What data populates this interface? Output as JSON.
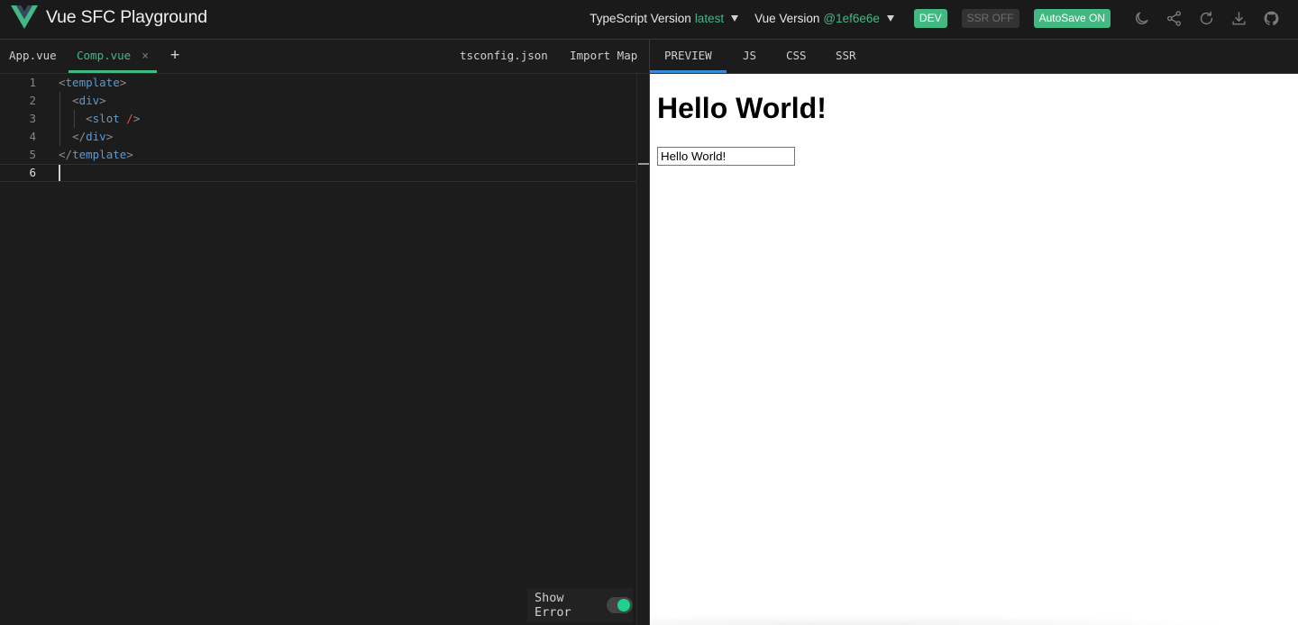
{
  "header": {
    "title": "Vue SFC Playground",
    "ts_label": "TypeScript Version",
    "ts_value": "latest",
    "vue_label": "Vue Version",
    "vue_value": "@1ef6e6e",
    "dev_label": "DEV",
    "ssr_label": "SSR OFF",
    "autosave_label": "AutoSave ON",
    "icons": [
      "moon-icon",
      "share-icon",
      "reload-icon",
      "download-icon",
      "github-icon"
    ]
  },
  "editor_tabs": {
    "files": [
      {
        "label": "App.vue",
        "active": false
      },
      {
        "label": "Comp.vue",
        "active": true,
        "close": "×"
      }
    ],
    "add": "+",
    "tsconfig": "tsconfig.json",
    "import_map": "Import Map"
  },
  "code": {
    "lines": [
      {
        "n": "1",
        "pre": "",
        "open": "<",
        "tag": "template",
        "close": ">"
      },
      {
        "n": "2",
        "pre": "  ",
        "open": "<",
        "tag": "div",
        "close": ">"
      },
      {
        "n": "3",
        "pre": "    ",
        "open": "<",
        "tag": "slot",
        "mid": " ",
        "red": "/",
        "close": ">"
      },
      {
        "n": "4",
        "pre": "  ",
        "open": "</",
        "tag": "div",
        "close": ">"
      },
      {
        "n": "5",
        "pre": "",
        "open": "</",
        "tag": "template",
        "close": ">"
      },
      {
        "n": "6",
        "pre": "",
        "open": "",
        "tag": "",
        "close": ""
      }
    ]
  },
  "show_error": {
    "label": "Show Error",
    "enabled": true
  },
  "output_tabs": [
    "PREVIEW",
    "JS",
    "CSS",
    "SSR"
  ],
  "preview": {
    "heading": "Hello World!",
    "input_value": "Hello World!"
  },
  "colors": {
    "accent": "#42b883",
    "tab_active_blue": "#3c8bd6",
    "toggle_on": "#1fd28f"
  }
}
